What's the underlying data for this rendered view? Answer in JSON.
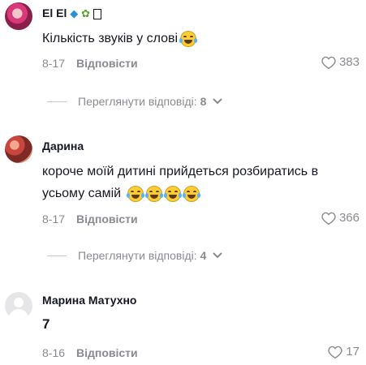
{
  "comments": [
    {
      "username": "El El",
      "username_emojis": [
        "💎",
        "🌱",
        "⬜"
      ],
      "text": "Кількість звуків у слові",
      "date": "8-17",
      "reply_label": "Відповісти",
      "likes": "383",
      "view_replies_label": "Переглянути відповіді:",
      "reply_count": "8"
    },
    {
      "username": "Дарина",
      "text": "короче моїй дитині прийдеться розбиратись в усьому самій",
      "date": "8-17",
      "reply_label": "Відповісти",
      "likes": "366",
      "view_replies_label": "Переглянути відповіді:",
      "reply_count": "4"
    },
    {
      "username": "Марина Матухно",
      "text": "7",
      "date": "8-16",
      "reply_label": "Відповісти",
      "likes": "17"
    }
  ],
  "colors": {
    "text": "#161823",
    "muted": "#8a8b91"
  }
}
